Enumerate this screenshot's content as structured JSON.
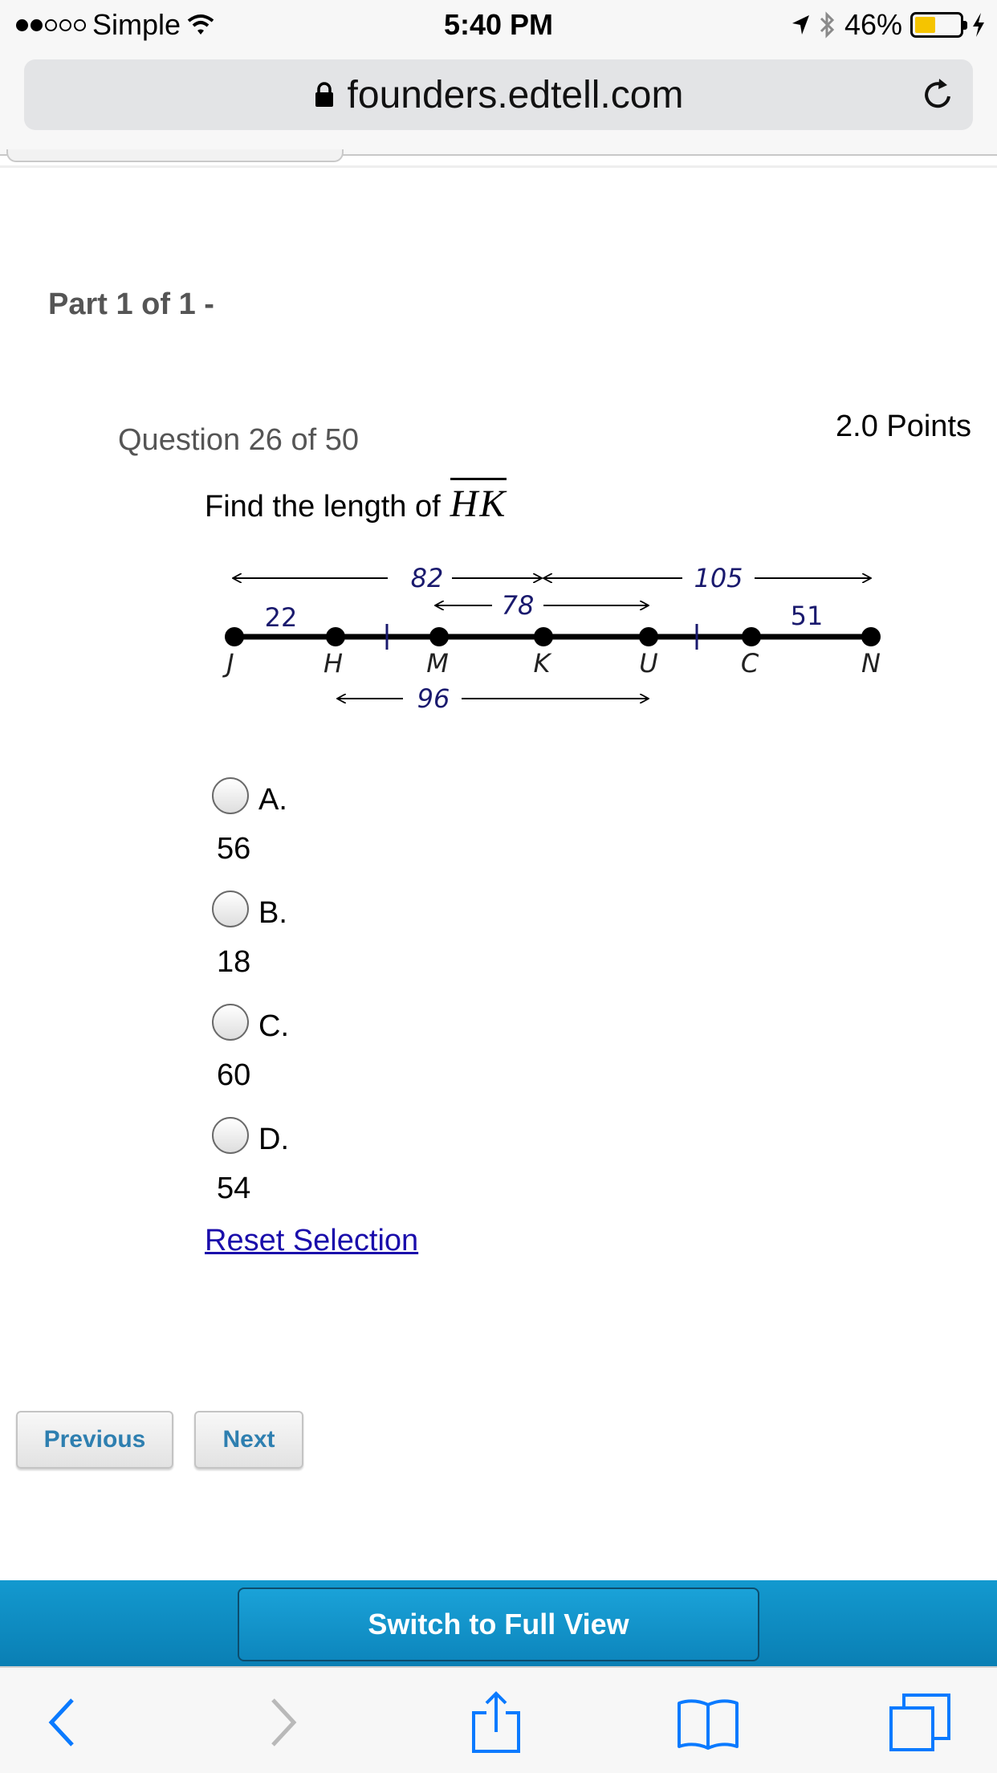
{
  "status_bar": {
    "signal_dots_filled": 2,
    "signal_dots_total": 5,
    "carrier": "Simple",
    "time": "5:40 PM",
    "battery_percent": "46%",
    "battery_level": 0.46,
    "battery_color": "#f5c400",
    "icons": [
      "wifi-icon",
      "location-arrow-icon",
      "bluetooth-icon",
      "battery-icon",
      "charging-bolt-icon"
    ]
  },
  "browser": {
    "url": "founders.edtell.com",
    "icons": [
      "lock-icon",
      "reload-icon"
    ]
  },
  "page": {
    "part_title": "Part 1 of 1 -",
    "question_number": "Question 26 of 50",
    "points": "2.0 Points",
    "prompt": "Find the length of",
    "segment": "HK"
  },
  "diagram": {
    "points": [
      "J",
      "H",
      "M",
      "K",
      "U",
      "C",
      "N"
    ],
    "measurements": {
      "JH": "22",
      "JK": "82",
      "MU": "78",
      "KN": "105",
      "CN": "51",
      "HU": "96"
    },
    "label_color": "#1a1a6e"
  },
  "options": [
    {
      "letter": "A.",
      "value": "56"
    },
    {
      "letter": "B.",
      "value": "18"
    },
    {
      "letter": "C.",
      "value": "60"
    },
    {
      "letter": "D.",
      "value": "54"
    }
  ],
  "reset_link": "Reset Selection",
  "navigation": {
    "previous": "Previous",
    "next": "Next"
  },
  "footer": {
    "switch_view": "Switch to Full View",
    "accent_color": "#1399cf"
  },
  "toolbar": {
    "icons": [
      "back-icon",
      "forward-icon",
      "share-icon",
      "bookmarks-icon",
      "tabs-icon"
    ]
  }
}
